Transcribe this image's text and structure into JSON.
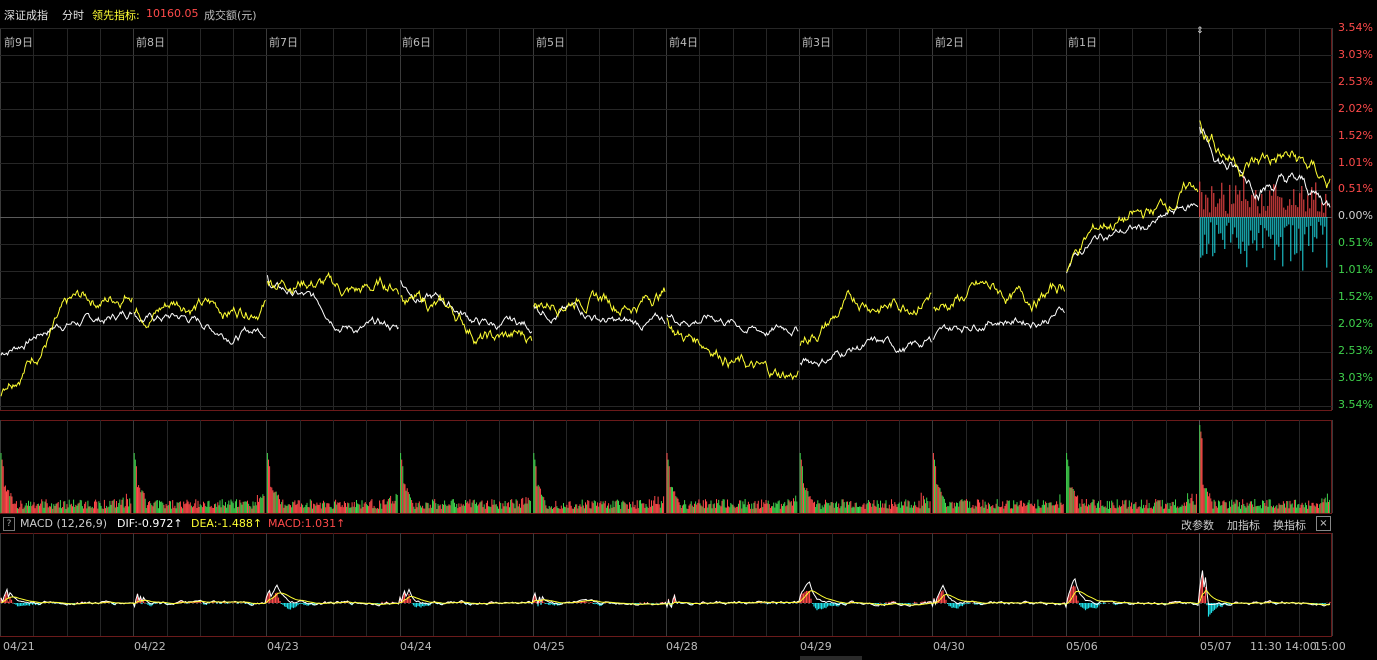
{
  "header": {
    "index_name": "深证成指",
    "mode_label": "分时",
    "lead_indicator_label": "领先指标:",
    "lead_indicator_value": "10160.05",
    "volume_label": "成交额(元)"
  },
  "day_labels": [
    "前9日",
    "前8日",
    "前7日",
    "前6日",
    "前5日",
    "前4日",
    "前3日",
    "前2日",
    "前1日"
  ],
  "pct_axis": [
    {
      "label": "3.54%",
      "color": "#ff4a4a"
    },
    {
      "label": "3.03%",
      "color": "#ff4a4a"
    },
    {
      "label": "2.53%",
      "color": "#ff4a4a"
    },
    {
      "label": "2.02%",
      "color": "#ff4a4a"
    },
    {
      "label": "1.52%",
      "color": "#ff4a4a"
    },
    {
      "label": "1.01%",
      "color": "#ff4a4a"
    },
    {
      "label": "0.51%",
      "color": "#ff4a4a"
    },
    {
      "label": "0.00%",
      "color": "#d0d0d0"
    },
    {
      "label": "0.51%",
      "color": "#3fd24c"
    },
    {
      "label": "1.01%",
      "color": "#3fd24c"
    },
    {
      "label": "1.52%",
      "color": "#3fd24c"
    },
    {
      "label": "2.02%",
      "color": "#3fd24c"
    },
    {
      "label": "2.53%",
      "color": "#3fd24c"
    },
    {
      "label": "3.03%",
      "color": "#3fd24c"
    },
    {
      "label": "3.54%",
      "color": "#3fd24c"
    }
  ],
  "macd": {
    "help_label": "?",
    "title": "MACD (12,26,9)",
    "dif": "DIF:-0.972↑",
    "dea": "DEA:-1.488↑",
    "macd": "MACD:1.031↑",
    "buttons": [
      "改参数",
      "加指标",
      "换指标"
    ],
    "close_label": "×"
  },
  "date_axis": [
    "04/21",
    "04/22",
    "04/23",
    "04/24",
    "04/25",
    "04/28",
    "04/29",
    "04/30",
    "05/06",
    "05/07",
    "11:30",
    "14:00",
    "15:00"
  ],
  "price_series": {
    "white_endpoints_pct": [
      [
        -2.55,
        -1.75
      ],
      [
        -1.75,
        -2.15
      ],
      [
        -1.05,
        -2.2
      ],
      [
        -1.15,
        -2.15
      ],
      [
        -1.55,
        -2.05
      ],
      [
        -1.75,
        -2.1
      ],
      [
        -2.7,
        -2.35
      ],
      [
        -2.25,
        -1.75
      ],
      [
        -0.95,
        0.15
      ]
    ],
    "yellow_endpoints_pct": [
      [
        -3.3,
        -1.2
      ],
      [
        -1.7,
        -1.6
      ],
      [
        -1.05,
        -1.4
      ],
      [
        -1.3,
        -2.4
      ],
      [
        -1.6,
        -1.45
      ],
      [
        -1.8,
        -3.05
      ],
      [
        -2.3,
        -1.35
      ],
      [
        -1.65,
        -1.4
      ],
      [
        -0.95,
        0.5
      ]
    ],
    "today_white_pct": [
      1.5,
      0.3
    ],
    "today_yellow_pct": [
      1.75,
      0.75
    ]
  },
  "colors": {
    "up": "#ff4a4a",
    "down": "#3fd24c",
    "cyan": "#1fe0e8",
    "white_line": "#ffffff",
    "yellow_line": "#ffff33",
    "grid": "#262626",
    "frame": "#6a1a1a"
  }
}
